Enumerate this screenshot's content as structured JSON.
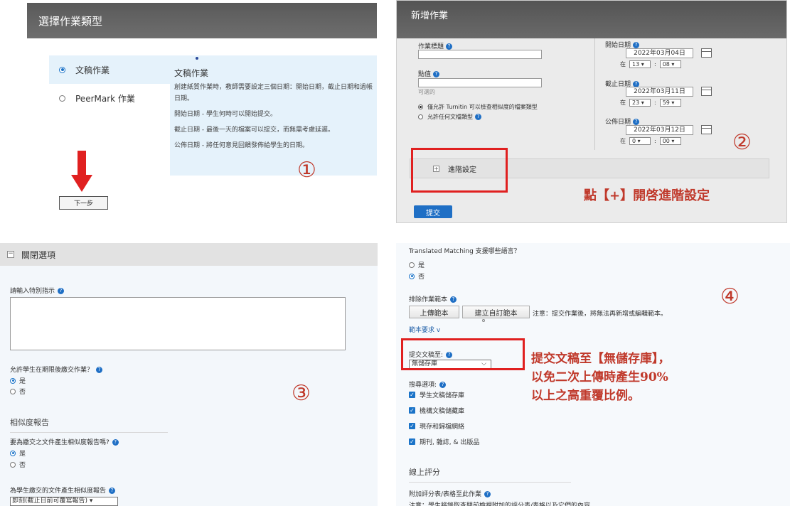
{
  "panel1": {
    "title": "選擇作業類型",
    "options": [
      {
        "label": "文稿作業",
        "selected": true
      },
      {
        "label": "PeerMark 作業",
        "selected": false
      }
    ],
    "desc_title": "文稿作業",
    "desc_paragraphs": [
      "創建紙質作業時，教師需要設定三個日期：開始日期，截止日期和過帳日期。",
      "開始日期 - 學生何時可以開始提交。",
      "截止日期 - 最後一天的檔案可以提交，而無需考慮延遲。",
      "公佈日期 - 將任何意見回饋發佈給學生的日期。"
    ],
    "next_button": "下一步",
    "step_marker": "①",
    "arrow_color": "#e02020"
  },
  "panel2": {
    "title": "新增作業",
    "title_label": "作業標題",
    "points_label": "點值",
    "points_hint": "可選的",
    "radio_allow_turnitin": "僅允許 Turnitin 可以檢查相似度的檔案類型",
    "radio_allow_any": "允許任何文檔類型",
    "start_label": "開始日期",
    "start_date": "2022年03月04日",
    "start_hour": "13",
    "start_min": "08",
    "due_label": "截止日期",
    "due_date": "2022年03月11日",
    "due_hour": "23",
    "due_min": "59",
    "post_label": "公佈日期",
    "post_date": "2022年03月12日",
    "post_hour": "0",
    "post_min": "00",
    "at_label": "在",
    "colon": ":",
    "advanced_label": "進階設定",
    "callout": "點【+】開啓進階設定",
    "step_marker": "②",
    "submit_label": "提交",
    "accent_color": "#1f6fc5"
  },
  "panel3": {
    "header": "關閉選項",
    "instructions_label": "請輸入特別指示",
    "late_label": "允許學生在期限後繳交作業？",
    "yes": "是",
    "no": "否",
    "similarity_section": "相似度報告",
    "similarity_q": "要為繳交之文件產生相似度報告嗎?",
    "generate_label": "為學生繳交的文件產生相似度報告",
    "generate_value": "即刻(截止日前可覆寫報告)",
    "step_marker": "③"
  },
  "panel4": {
    "translated_q": "Translated Matching 支援哪些語言？",
    "yes": "是",
    "no": "否",
    "exclude_label": "排除作業範本",
    "upload_template": "上傳範本",
    "create_template": "建立自訂範本",
    "note": "注意：提交作業後，將無法再新增或編輯範本。",
    "template_req": "範本要求 v",
    "submit_to_label": "提交文稿至:",
    "submit_to_value": "無儲存庫",
    "search_options_label": "搜尋選項:",
    "checks": [
      "學生文稿儲存庫",
      "機構文稿儲藏庫",
      "現存和歸檔網絡",
      "期刊, 雜誌, & 出版品"
    ],
    "callout_lines": [
      "提交文稿至【無儲存庫】，",
      "以免二次上傳時產生90%",
      "以上之高重覆比例。"
    ],
    "online_grading": "線上評分",
    "rubric_label": "附加評分表/表格至此作業",
    "rubric_note": "注意：學生將錄取查閱前檢視附加的評分表/表格以及它們的內容。",
    "step_marker": "④"
  }
}
